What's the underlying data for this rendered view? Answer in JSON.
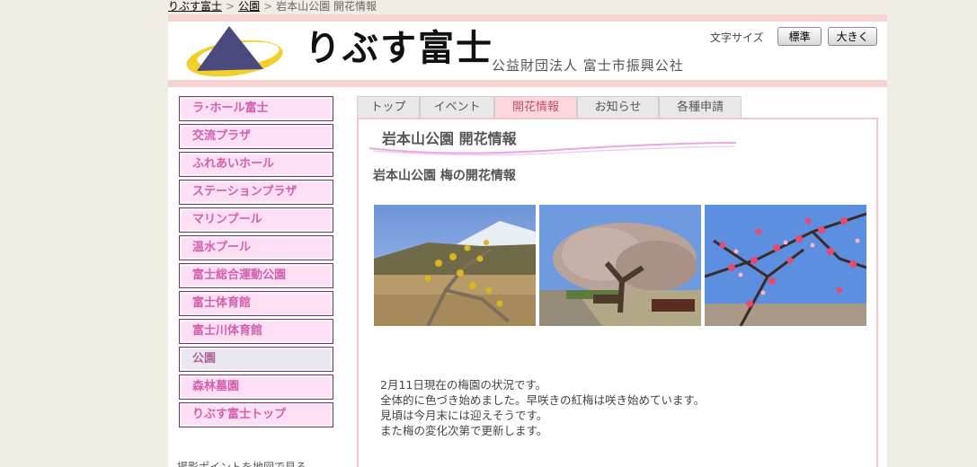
{
  "breadcrumb": {
    "home": "りぶす富士",
    "parent": "公園",
    "current": "岩本山公園 開花情報",
    "sep": ">"
  },
  "header": {
    "logo_text": "りぶす富士",
    "org_name": "公益財団法人 富士市振興公社",
    "font_size_label": "文字サイズ",
    "btn_standard": "標準",
    "btn_large": "大きく"
  },
  "sidebar": {
    "items": [
      {
        "label": "ラ･ホール富士"
      },
      {
        "label": "交流プラザ"
      },
      {
        "label": "ふれあいホール"
      },
      {
        "label": "ステーションプラザ"
      },
      {
        "label": "マリンプール"
      },
      {
        "label": "温水プール"
      },
      {
        "label": "富士総合運動公園"
      },
      {
        "label": "富士体育館"
      },
      {
        "label": "富士川体育館"
      },
      {
        "label": "公園",
        "active": true
      },
      {
        "label": "森林墓園"
      },
      {
        "label": "りぶす富士トップ"
      }
    ],
    "bottom_text": "撮影ポイントを地図で見る"
  },
  "tabs": [
    {
      "label": "トップ"
    },
    {
      "label": "イベント"
    },
    {
      "label": "開花情報",
      "active": true
    },
    {
      "label": "お知らせ"
    },
    {
      "label": "各種申請"
    }
  ],
  "main": {
    "title": "岩本山公園 開花情報",
    "section_title": "岩本山公園 梅の開花情報",
    "description": [
      "2月11日現在の梅園の状況です。",
      "全体的に色づき始めました。早咲きの紅梅は咲き始めています。",
      "見頃は今月末には迎えそうです。",
      "また梅の変化次第で更新します。"
    ]
  },
  "colors": {
    "accent_pink": "#f9d2d2",
    "menu_bg": "#fcdff3",
    "menu_text": "#d45fae",
    "menu_border": "#6b3b76",
    "active_tab": "#fcd8dc"
  }
}
